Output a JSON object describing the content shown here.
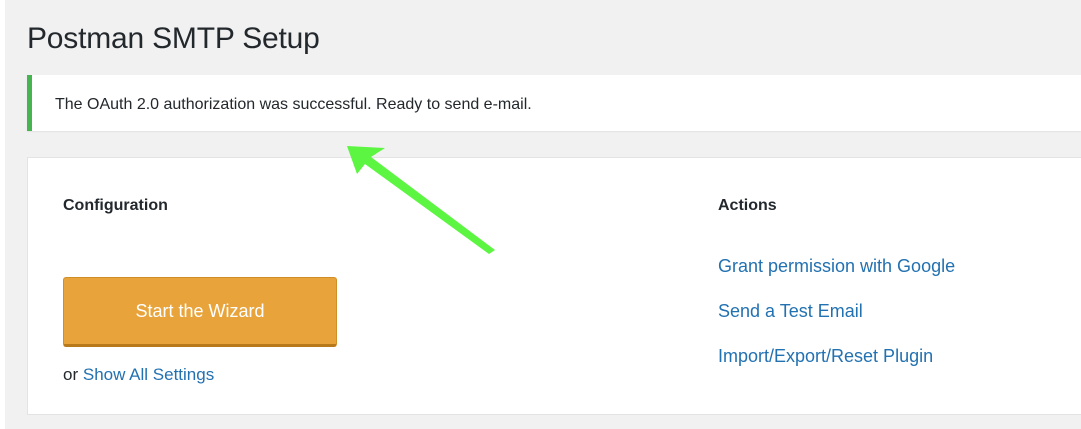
{
  "page": {
    "title": "Postman SMTP Setup"
  },
  "notice": {
    "message": "The OAuth 2.0 authorization was successful. Ready to send e-mail.",
    "accent_color": "#46b450"
  },
  "configuration": {
    "heading": "Configuration",
    "wizard_button_label": "Start the Wizard",
    "or_prefix": "or",
    "show_all_settings_link": "Show All Settings",
    "button_color": "#e8a43b"
  },
  "actions": {
    "heading": "Actions",
    "items": [
      {
        "label": "Grant permission with Google"
      },
      {
        "label": "Send a Test Email"
      },
      {
        "label": "Import/Export/Reset Plugin"
      }
    ],
    "link_color": "#2271b1"
  },
  "annotation": {
    "arrow_icon": "annotation-arrow-icon",
    "arrow_color": "#5cf542"
  }
}
